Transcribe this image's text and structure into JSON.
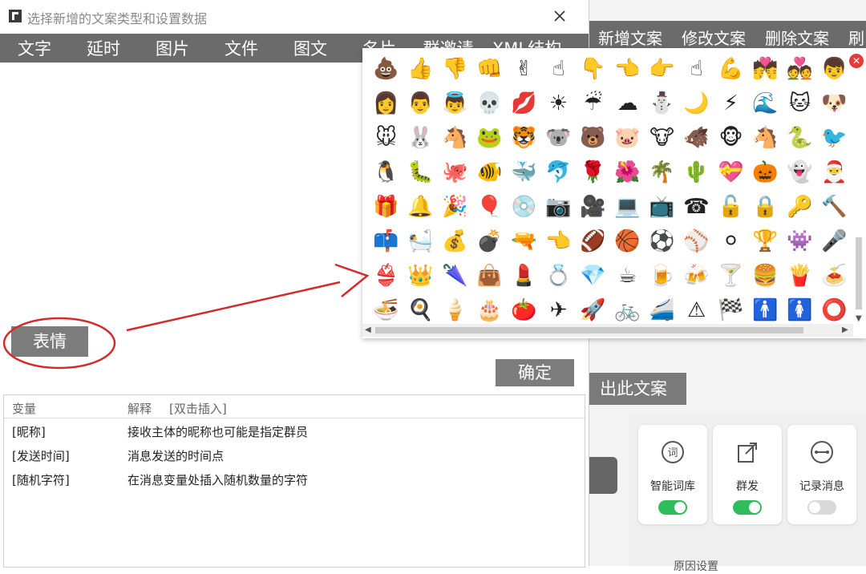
{
  "dialog": {
    "title": "选择新增的文案类型和设置数据",
    "close_glyph": "✕",
    "type_tabs": [
      "文字",
      "延时",
      "图片",
      "文件",
      "图文",
      "名片",
      "群邀请",
      "XML结构"
    ],
    "emoji_button": "表情",
    "confirm_button": "确定"
  },
  "variables": {
    "headers": {
      "var": "变量",
      "desc": "解释",
      "hint": "[双击插入]"
    },
    "rows": [
      {
        "var": "[昵称]",
        "desc": "接收主体的昵称也可能是指定群员"
      },
      {
        "var": "[发送时间]",
        "desc": "消息发送的时间点"
      },
      {
        "var": "[随机字符]",
        "desc": "在消息变量处插入随机数量的字符"
      }
    ]
  },
  "background": {
    "toolbar": [
      "新增文案",
      "修改文案",
      "删除文案",
      "刷"
    ],
    "export_button": "出此文案",
    "features": [
      {
        "label": "智能词库",
        "icon": "ci-icon",
        "icon_char": "词",
        "on": true
      },
      {
        "label": "群发",
        "icon": "share-icon",
        "icon_char": "",
        "on": true
      },
      {
        "label": "记录消息",
        "icon": "link-icon",
        "icon_char": "",
        "on": false
      }
    ],
    "bottom_text": "原因设置",
    "toggle_on_color": "#2ebd5a"
  },
  "emoji_picker": {
    "close_glyph": "✕",
    "emojis": [
      "💩",
      "👍",
      "👎",
      "👊",
      "✌",
      "☝",
      "👇",
      "👈",
      "👉",
      "☝",
      "💪",
      "💏",
      "💑",
      "👦",
      "👩",
      "👨",
      "👼",
      "💀",
      "💋",
      "☀",
      "☔",
      "☁",
      "⛄",
      "🌙",
      "⚡",
      "🌊",
      "🐱",
      "🐶",
      "🐭",
      "🐰",
      "🐴",
      "🐸",
      "🐯",
      "🐨",
      "🐻",
      "🐷",
      "🐮",
      "🐗",
      "🐵",
      "🐴",
      "🐍",
      "🐦",
      "🐧",
      "🐛",
      "🐙",
      "🐠",
      "🐳",
      "🐬",
      "🌹",
      "🌺",
      "🌴",
      "🌵",
      "💝",
      "🎃",
      "👻",
      "🎅",
      "🎁",
      "🔔",
      "🎉",
      "🎈",
      "💿",
      "📷",
      "🎥",
      "💻",
      "📺",
      "☎",
      "🔓",
      "🔒",
      "🔑",
      "🔨",
      "📫",
      "🛀",
      "💰",
      "💣",
      "🔫",
      "👈",
      "🏈",
      "🏀",
      "⚽",
      "⚾",
      "⚪",
      "🏆",
      "👾",
      "🎤",
      "👙",
      "👑",
      "🌂",
      "👜",
      "💄",
      "💍",
      "💎",
      "☕",
      "🍺",
      "🍻",
      "🍸",
      "🍔",
      "🍟",
      "🍝",
      "🍜",
      "🍳",
      "🍦",
      "🎂",
      "🍅",
      "✈",
      "🚀",
      "🚲",
      "🚄",
      "⚠",
      "🏁",
      "🚹",
      "🚺",
      "⭕"
    ]
  }
}
